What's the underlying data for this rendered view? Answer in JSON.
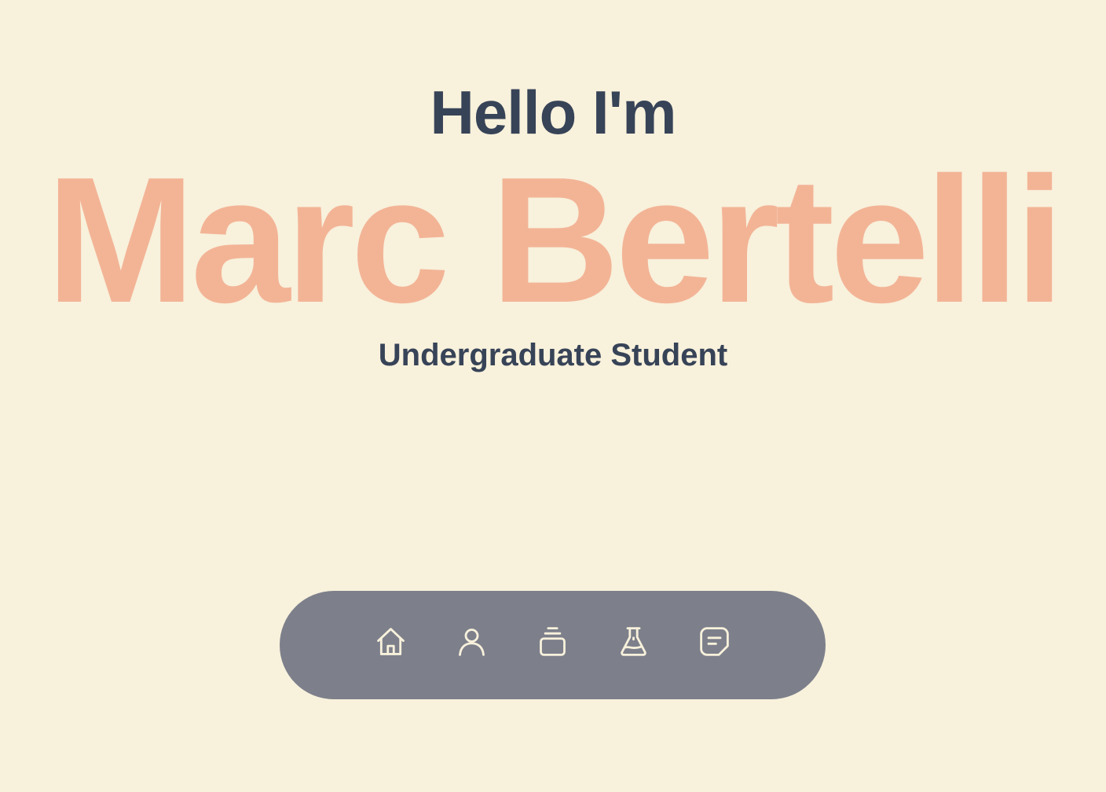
{
  "hero": {
    "greeting": "Hello I'm",
    "name": "Marc Bertelli",
    "role": "Undergraduate Student"
  },
  "dock": {
    "items": [
      {
        "icon": "home-icon"
      },
      {
        "icon": "user-icon"
      },
      {
        "icon": "stack-icon"
      },
      {
        "icon": "flask-icon"
      },
      {
        "icon": "message-icon"
      }
    ]
  },
  "colors": {
    "background": "#f8f1dc",
    "text_dark": "#374357",
    "accent": "#f3b496",
    "dock": "#7d808b",
    "dock_icon": "#f8f1dc"
  }
}
